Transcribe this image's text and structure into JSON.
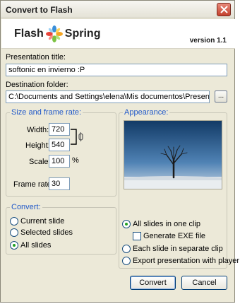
{
  "window": {
    "title": "Convert to Flash"
  },
  "banner": {
    "logo_left": "Flash",
    "logo_right": "Spring",
    "version": "version 1.1"
  },
  "presentation": {
    "label": "Presentation title:",
    "value": "softonic en invierno :P"
  },
  "destination": {
    "label": "Destination folder:",
    "value": "C:\\Documents and Settings\\elena\\Mis documentos\\Presentations",
    "browse_label": "..."
  },
  "size": {
    "group_title": "Size and frame rate:",
    "width_label": "Width:",
    "width_value": "720",
    "height_label": "Height:",
    "height_value": "540",
    "scale_label": "Scale:",
    "scale_value": "100",
    "scale_unit": "%",
    "framerate_label": "Frame rate:",
    "framerate_value": "30"
  },
  "convert": {
    "group_title": "Convert:",
    "options": [
      "Current slide",
      "Selected slides",
      "All slides"
    ],
    "selected": "All slides"
  },
  "appearance": {
    "group_title": "Appearance:",
    "all_in_one": "All slides in one clip",
    "generate_exe": "Generate EXE file",
    "separate_clip": "Each slide in separate clip",
    "export_player": "Export presentation with player",
    "selected": "All slides in one clip",
    "generate_exe_checked": false
  },
  "buttons": {
    "convert": "Convert",
    "cancel": "Cancel"
  }
}
